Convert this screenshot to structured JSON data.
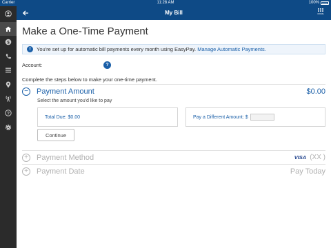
{
  "status_bar": {
    "carrier": "Carrier",
    "time": "11:28 AM",
    "battery": "100%"
  },
  "app_bar": {
    "title": "My Bill",
    "more_label": "MORE"
  },
  "page": {
    "title": "Make a One-Time Payment",
    "info_text": "You're set up for automatic bill payments every month using EasyPay.",
    "info_link": "Manage Automatic Payments.",
    "account_label": "Account:",
    "steps_intro": "Complete the steps below to make your one-time payment."
  },
  "payment_amount": {
    "heading": "Payment Amount",
    "amount": "$0.00",
    "select_text": "Select the amount you'd like to pay",
    "total_due": "Total Due: $0.00",
    "different_amount_label": "Pay a Different Amount: $",
    "different_amount_value": "",
    "continue_label": "Continue"
  },
  "payment_method": {
    "heading": "Payment Method",
    "card_brand": "VISA",
    "card_mask": "(XX        )"
  },
  "payment_date": {
    "heading": "Payment Date",
    "value": "Pay Today"
  },
  "sidebar_icons": [
    "account-icon",
    "home-icon",
    "billing-icon",
    "phone-icon",
    "list-icon",
    "location-icon",
    "network-icon",
    "help-icon",
    "settings-icon"
  ],
  "colors": {
    "brand_blue": "#0e4a86",
    "link_blue": "#1a5fa8",
    "sidebar": "#2b2b2b"
  }
}
